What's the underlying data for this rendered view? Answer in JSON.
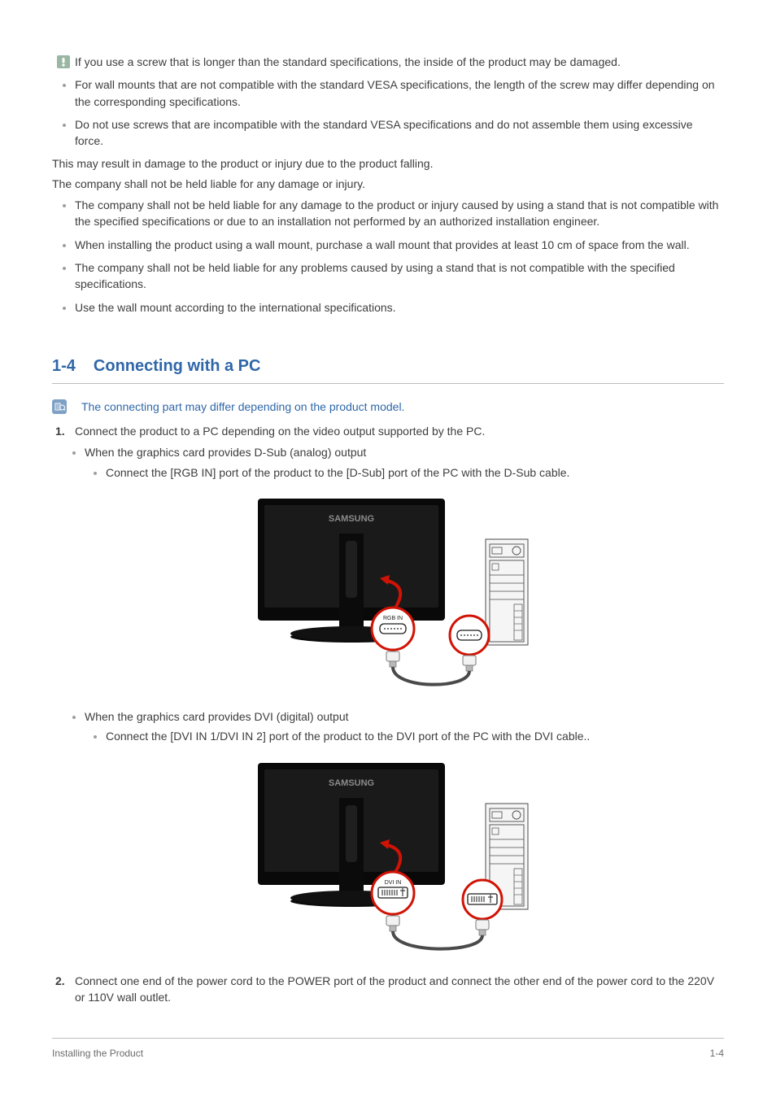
{
  "caution_bullets": [
    "If you use a screw that is longer than the standard specifications, the inside of the product may be damaged.",
    "For wall mounts that are not compatible with the standard VESA specifications, the length of the screw may differ depending on the corresponding specifications.",
    "Do not use screws that are incompatible with the standard VESA specifications and do not assemble them using excessive force."
  ],
  "body_lines": [
    "This may result in damage to the product or injury due to the product falling.",
    "The company shall not be held liable for any damage or injury."
  ],
  "liability_bullets": [
    "The company shall not be held liable for any damage to the product or injury caused by using a stand that is not compatible with the specified specifications or due to an installation not performed by an authorized installation engineer.",
    "When installing the product using a wall mount, purchase a wall mount that provides at least 10 cm of space from the wall.",
    "The company shall not be held liable for any problems caused by using a stand that is not compatible with the specified specifications.",
    "Use the wall mount according to the international specifications."
  ],
  "section": {
    "number": "1-4",
    "title": "Connecting with a PC"
  },
  "note": "The connecting part may differ depending on the product model.",
  "step1": "Connect the product to a PC depending on the video output supported by the PC.",
  "dsub": {
    "when": "When the graphics card provides D-Sub (analog) output",
    "how": "Connect the [RGB IN] port of the product to the [D-Sub] port of the PC with the D-Sub cable."
  },
  "dvi": {
    "when": "When the graphics card provides DVI (digital) output",
    "how": "Connect the [DVI IN 1/DVI IN 2] port of the product to the DVI port of the PC with the DVI cable.."
  },
  "step2": "Connect one end of the power cord to the POWER port of the product and connect the other end of the power cord to the 220V or 110V wall outlet.",
  "fig_labels": {
    "brand": "SAMSUNG",
    "rgb": "RGB IN",
    "dvi": "DVI IN"
  },
  "footer": {
    "left": "Installing the Product",
    "right": "1-4"
  }
}
